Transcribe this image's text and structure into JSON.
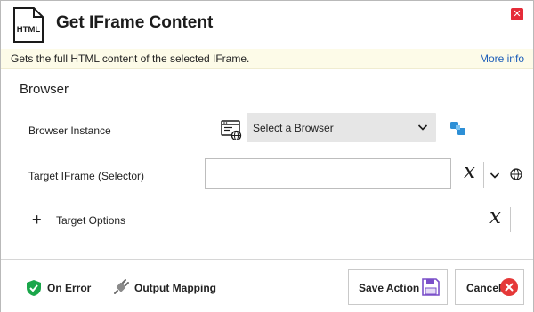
{
  "dialog": {
    "title": "Get IFrame Content",
    "close_icon": "close-icon",
    "doc_icon_text": "HTML",
    "description": "Gets the full HTML content of the selected IFrame.",
    "more_info": "More info"
  },
  "section": {
    "title": "Browser"
  },
  "fields": {
    "browser_instance": {
      "label": "Browser Instance",
      "value": "Select a Browser"
    },
    "target_iframe": {
      "label": "Target IFrame (Selector)",
      "value": ""
    },
    "target_options": {
      "label": "Target Options",
      "expand_symbol": "+"
    }
  },
  "variable_symbol": "x",
  "footer": {
    "on_error": "On Error",
    "output_mapping": "Output Mapping",
    "save_action": "Save Action",
    "cancel": "Cancel"
  },
  "colors": {
    "accent_blue": "#1f5fb9",
    "info_bg": "#fdfbe8",
    "close_red": "#e52b38",
    "shield_green": "#1aa64a",
    "save_purple": "#7a4fc9"
  }
}
